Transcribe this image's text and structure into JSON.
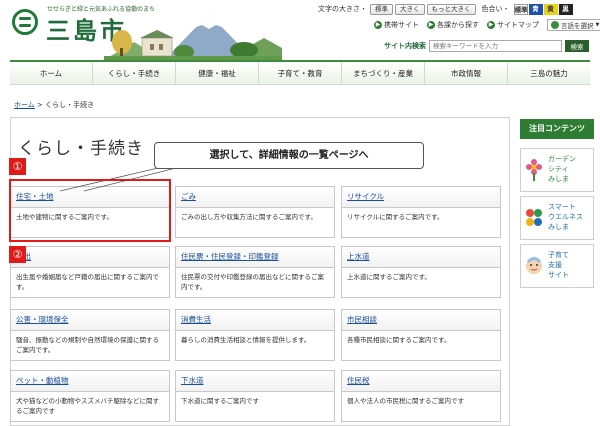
{
  "header": {
    "tagline": "せせらぎと緑と元気あふれる協働のまち",
    "city_name": "三島市"
  },
  "utility": {
    "text_size_label": "文字の大きさ・",
    "size_buttons": [
      "標準",
      "大きく",
      "もっと大きく"
    ],
    "color_label": "色合い・",
    "color_buttons": [
      {
        "label": "標準",
        "bg": "#ffffff",
        "fg": "#333333"
      },
      {
        "label": "青",
        "bg": "#1f4fa8",
        "fg": "#ffffff"
      },
      {
        "label": "黄",
        "bg": "#e8d21a",
        "fg": "#333333"
      },
      {
        "label": "黒",
        "bg": "#222222",
        "fg": "#ffffff"
      }
    ],
    "links": [
      "携帯サイト",
      "各課から探す",
      "サイトマップ"
    ],
    "language_label": "言語を選択",
    "language_arrow": "▼"
  },
  "search": {
    "label": "サイト内検索",
    "placeholder": "検索キーワードを入力",
    "button": "検索"
  },
  "nav": [
    "ホーム",
    "くらし・手続き",
    "健康・福祉",
    "子育て・教育",
    "まちづくり・産業",
    "市政情報",
    "三島の魅力"
  ],
  "breadcrumb": {
    "home": "ホーム",
    "separator": " > ",
    "current": "くらし・手続き"
  },
  "page": {
    "title": "くらし・手続き"
  },
  "annotation": {
    "callout": "選択して、詳細情報の一覧ページへ",
    "marker1": "①",
    "marker2": "②"
  },
  "categories": [
    {
      "title": "住宅・土地",
      "desc": "土地や建物に関するご案内です。"
    },
    {
      "title": "ごみ",
      "desc": "ごみの出し方や収集方法に関するご案内です。"
    },
    {
      "title": "リサイクル",
      "desc": "リサイクルに関するご案内です。"
    },
    {
      "title": "届出",
      "desc": "出生届や婚姻届など戸籍の届出に関するご案内です。"
    },
    {
      "title": "住民票・住民登録・印鑑登録",
      "desc": "住民票の交付や印鑑登録の届出などに関するご案内です。"
    },
    {
      "title": "上水道",
      "desc": "上水道に関するご案内です。"
    },
    {
      "title": "公害・環境保全",
      "desc": "騒音、振動などの規制や自然環境の保護に関するご案内です。"
    },
    {
      "title": "消費生活",
      "desc": "暮らしの消費生活相談と情報を提供します。"
    },
    {
      "title": "市民相談",
      "desc": "各種市民相談に関するご案内です。"
    },
    {
      "title": "ペット・動植物",
      "desc": "犬や猫などの小動物やスズメバチ駆除などに関するご案内です"
    },
    {
      "title": "下水道",
      "desc": "下水道に関するご案内です"
    },
    {
      "title": "住民税",
      "desc": "個人や法人の市民税に関するご案内です"
    }
  ],
  "sidebar": {
    "title": "注目コンテンツ",
    "items": [
      {
        "label": "ガーデン\nシティ\nみしま",
        "color": "#2e8b3a",
        "icon": "flower-icon"
      },
      {
        "label": "スマート\nウエルネス\nみしま",
        "color": "#1f6fb5",
        "icon": "wellness-icon"
      },
      {
        "label": "子育て\n支援\nサイト",
        "color": "#1f6fb5",
        "icon": "baby-icon"
      }
    ]
  }
}
